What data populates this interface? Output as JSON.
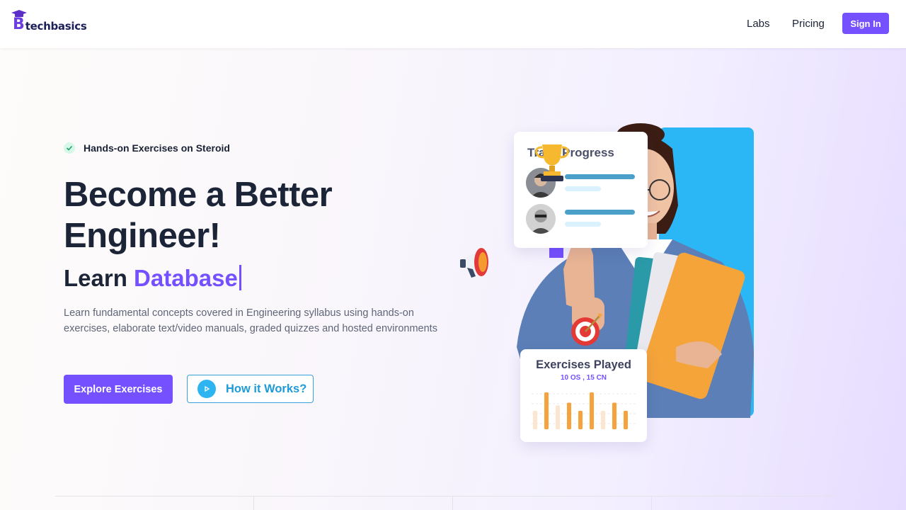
{
  "header": {
    "logo_letter": "B",
    "logo_text": "techbasics",
    "nav": {
      "labs": "Labs",
      "pricing": "Pricing"
    },
    "signin_label": "Sign In"
  },
  "hero": {
    "badge": "Hands-on Exercises on Steroid",
    "title": "Become a Better Engineer!",
    "learn_prefix": "Learn",
    "learn_word": "Database",
    "description": "Learn fundamental concepts covered in Engineering syllabus using hands-on exercises, elaborate text/video manuals, graded quizzes and hosted environments",
    "explore_label": "Explore Exercises",
    "how_label": "How it Works?"
  },
  "illustration": {
    "progress_card": {
      "title": "Track Progress"
    },
    "exercises_card": {
      "title": "Exercises Played",
      "subtitle": "10 OS , 15 CN",
      "bars": [
        {
          "value": 0.5,
          "color": "#fce6cf"
        },
        {
          "value": 1.0,
          "color": "#f6a23d"
        },
        {
          "value": 0.65,
          "color": "#fce6cf"
        },
        {
          "value": 0.72,
          "color": "#f6a23d"
        },
        {
          "value": 0.5,
          "color": "#f6a23d"
        },
        {
          "value": 1.0,
          "color": "#f6a23d"
        },
        {
          "value": 0.5,
          "color": "#fce6cf"
        },
        {
          "value": 0.72,
          "color": "#f6a23d"
        },
        {
          "value": 0.5,
          "color": "#f6a23d"
        }
      ]
    }
  },
  "colors": {
    "accent": "#7450ff",
    "blue": "#2bb7f5",
    "text_dark": "#1c2537",
    "muted": "#5e6678"
  }
}
